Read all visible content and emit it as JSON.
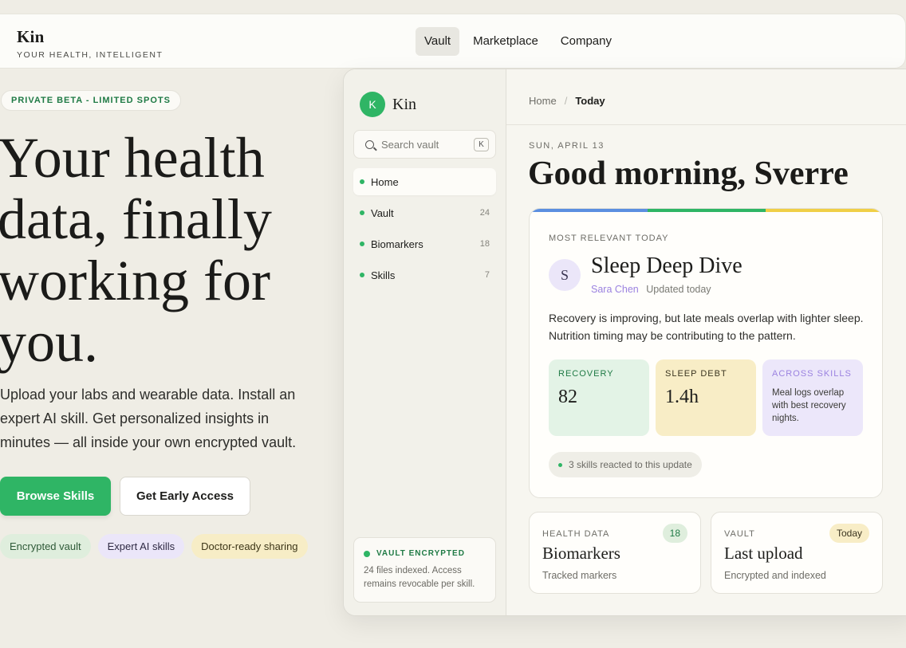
{
  "brand": {
    "name": "Kin",
    "tagline": "YOUR HEALTH, INTELLIGENT"
  },
  "nav": {
    "links": [
      {
        "label": "Vault",
        "active": true
      },
      {
        "label": "Marketplace",
        "active": false
      },
      {
        "label": "Company",
        "active": false
      }
    ]
  },
  "hero": {
    "badge": "PRIVATE BETA - LIMITED SPOTS",
    "title_lines": [
      "Your health",
      "data, finally",
      "working for",
      "you."
    ],
    "subtitle": "Upload your labs and wearable data. Install an expert AI skill. Get personalized insights in minutes — all inside your own encrypted vault.",
    "primary_cta": "Browse Skills",
    "secondary_cta": "Get Early Access",
    "chips": [
      "Encrypted vault",
      "Expert AI skills",
      "Doctor-ready sharing"
    ]
  },
  "app": {
    "logo_letter": "K",
    "name": "Kin",
    "search": {
      "placeholder": "Search vault",
      "shortcut": "K"
    },
    "sidebar": [
      {
        "label": "Home",
        "count": ""
      },
      {
        "label": "Vault",
        "count": "24"
      },
      {
        "label": "Biomarkers",
        "count": "18"
      },
      {
        "label": "Skills",
        "count": "7"
      }
    ],
    "encrypted": {
      "title": "VAULT ENCRYPTED",
      "desc": "24 files indexed. Access remains revocable per skill."
    },
    "breadcrumb": {
      "home": "Home",
      "sep": "/",
      "current": "Today"
    },
    "date": "SUN, APRIL 13",
    "greeting": "Good morning, Sverre",
    "feature": {
      "label": "MOST RELEVANT TODAY",
      "avatar": "S",
      "title": "Sleep Deep Dive",
      "author": "Sara Chen",
      "updated": "Updated today",
      "body": "Recovery is improving, but late meals overlap with lighter sleep. Nutrition timing may be contributing to the pattern.",
      "accent_colors": [
        "#5b8fe0",
        "#2fb565",
        "#f0cf46"
      ],
      "stats": [
        {
          "label": "RECOVERY",
          "value": "82"
        },
        {
          "label": "SLEEP DEBT",
          "value": "1.4h"
        },
        {
          "label": "ACROSS SKILLS",
          "text": "Meal logs overlap with best recovery nights."
        }
      ],
      "reacted": "3 skills reacted to this update"
    },
    "cards": [
      {
        "label": "HEALTH DATA",
        "title": "Biomarkers",
        "sub": "Tracked markers",
        "badge": "18"
      },
      {
        "label": "VAULT",
        "title": "Last upload",
        "sub": "Encrypted and indexed",
        "badge": "Today"
      }
    ]
  }
}
